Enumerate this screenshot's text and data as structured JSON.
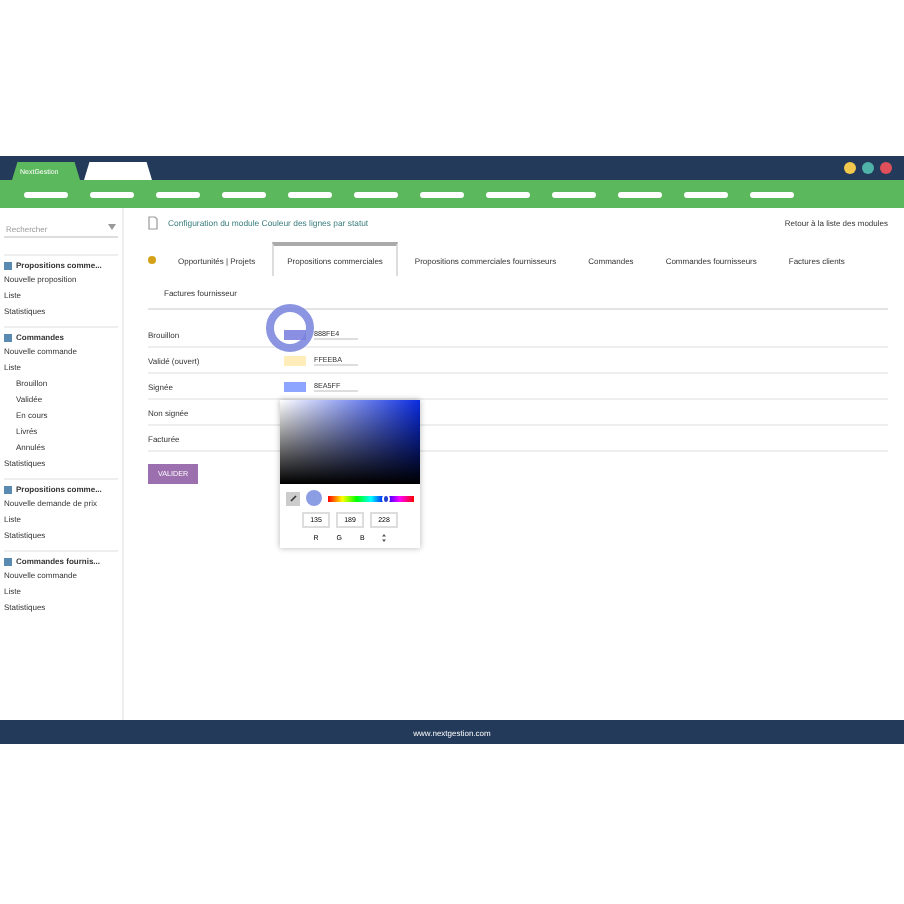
{
  "app_tab": {
    "label": "NextGestion"
  },
  "window_dots": [
    {
      "color": "#f2c94c"
    },
    {
      "color": "#4fb3a9"
    },
    {
      "color": "#e0505a"
    }
  ],
  "sidebar": {
    "search": {
      "placeholder": "Rechercher"
    },
    "groups": [
      {
        "title": "Propositions comme...",
        "items": [
          {
            "label": "Nouvelle proposition"
          },
          {
            "label": "Liste"
          },
          {
            "label": "Statistiques"
          }
        ]
      },
      {
        "title": "Commandes",
        "items": [
          {
            "label": "Nouvelle commande"
          },
          {
            "label": "Liste",
            "children": [
              {
                "label": "Brouillon"
              },
              {
                "label": "Validée"
              },
              {
                "label": "En cours"
              },
              {
                "label": "Livrés"
              },
              {
                "label": "Annulés"
              }
            ]
          },
          {
            "label": "Statistiques"
          }
        ]
      },
      {
        "title": "Propositions comme...",
        "items": [
          {
            "label": "Nouvelle demande de prix"
          },
          {
            "label": "Liste"
          },
          {
            "label": "Statistiques"
          }
        ]
      },
      {
        "title": "Commandes fournis...",
        "items": [
          {
            "label": "Nouvelle commande"
          },
          {
            "label": "Liste"
          },
          {
            "label": "Statistiques"
          }
        ]
      }
    ]
  },
  "header": {
    "title": "Configuration du module Couleur des lignes par statut",
    "back_link": "Retour à la liste des modules"
  },
  "tabs": [
    {
      "label": "Opportunités | Projets",
      "selected": false
    },
    {
      "label": "Propositions commerciales",
      "selected": true
    },
    {
      "label": "Propositions commerciales fournisseurs",
      "selected": false
    },
    {
      "label": "Commandes",
      "selected": false
    },
    {
      "label": "Commandes fournisseurs",
      "selected": false
    },
    {
      "label": "Factures clients",
      "selected": false
    },
    {
      "label": "Factures fournisseur",
      "selected": false
    }
  ],
  "rows": [
    {
      "label": "Brouillon",
      "hex": "888FE4",
      "color": "#8b8fe4"
    },
    {
      "label": "Validé (ouvert)",
      "hex": "FFEEBA",
      "color": "#ffeeba"
    },
    {
      "label": "Signée",
      "hex": "8EA5FF",
      "color": "#8ea5ff"
    },
    {
      "label": "Non signée"
    },
    {
      "label": "Facturée"
    }
  ],
  "picker": {
    "values": [
      "135",
      "189",
      "228"
    ],
    "labels": [
      "R",
      "G",
      "B"
    ],
    "hue": {
      "level": 0.68
    }
  },
  "submit": "VALIDER",
  "footer": "www.nextgestion.com"
}
